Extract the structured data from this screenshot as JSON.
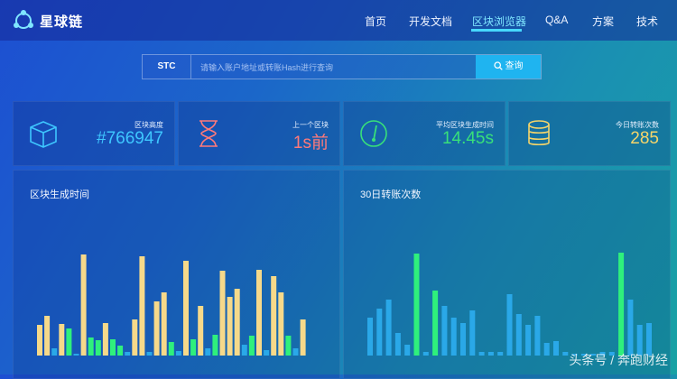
{
  "header": {
    "logo_text": "星球链",
    "nav": [
      {
        "label": "首页"
      },
      {
        "label": "开发文档"
      },
      {
        "label": "区块浏览器",
        "active": true
      },
      {
        "label": "Q&A"
      },
      {
        "label": "方案"
      },
      {
        "label": "技术"
      }
    ]
  },
  "search": {
    "token": "STC",
    "placeholder": "请输入账户地址或转账Hash进行查询",
    "button_label": "查询"
  },
  "stats": [
    {
      "icon": "cube-icon",
      "label": "区块高度",
      "value": "#766947",
      "color": "#3ec7ff"
    },
    {
      "icon": "hourglass-icon",
      "label": "上一个区块",
      "value": "1s前",
      "color": "#ff7a7a"
    },
    {
      "icon": "gauge-icon",
      "label": "平均区块生成时间",
      "value": "14.45s",
      "color": "#38e07a"
    },
    {
      "icon": "database-icon",
      "label": "今日转账次数",
      "value": "285",
      "color": "#f5d56a"
    }
  ],
  "panels": {
    "block_time_title": "区块生成时间",
    "tx_count_title": "30日转账次数"
  },
  "watermark": "头条号 / 奔跑财经",
  "chart_data": [
    {
      "type": "bar",
      "title": "区块生成时间",
      "colors": {
        "yellow": "#f6d98a",
        "green": "#2ff07c",
        "blue": "#2aa8e8"
      },
      "values": [
        {
          "v": 34,
          "c": "yellow"
        },
        {
          "v": 44,
          "c": "yellow"
        },
        {
          "v": 8,
          "c": "blue"
        },
        {
          "v": 35,
          "c": "yellow"
        },
        {
          "v": 30,
          "c": "green"
        },
        {
          "v": 2,
          "c": "blue"
        },
        {
          "v": 112,
          "c": "yellow"
        },
        {
          "v": 20,
          "c": "green"
        },
        {
          "v": 17,
          "c": "green"
        },
        {
          "v": 36,
          "c": "yellow"
        },
        {
          "v": 18,
          "c": "green"
        },
        {
          "v": 11,
          "c": "green"
        },
        {
          "v": 4,
          "c": "blue"
        },
        {
          "v": 40,
          "c": "yellow"
        },
        {
          "v": 110,
          "c": "yellow"
        },
        {
          "v": 4,
          "c": "blue"
        },
        {
          "v": 60,
          "c": "yellow"
        },
        {
          "v": 70,
          "c": "yellow"
        },
        {
          "v": 15,
          "c": "green"
        },
        {
          "v": 5,
          "c": "blue"
        },
        {
          "v": 105,
          "c": "yellow"
        },
        {
          "v": 18,
          "c": "green"
        },
        {
          "v": 55,
          "c": "yellow"
        },
        {
          "v": 8,
          "c": "blue"
        },
        {
          "v": 23,
          "c": "green"
        },
        {
          "v": 94,
          "c": "yellow"
        },
        {
          "v": 65,
          "c": "yellow"
        },
        {
          "v": 74,
          "c": "yellow"
        },
        {
          "v": 12,
          "c": "blue"
        },
        {
          "v": 22,
          "c": "green"
        },
        {
          "v": 95,
          "c": "yellow"
        },
        {
          "v": 6,
          "c": "blue"
        },
        {
          "v": 88,
          "c": "yellow"
        },
        {
          "v": 70,
          "c": "yellow"
        },
        {
          "v": 22,
          "c": "green"
        },
        {
          "v": 8,
          "c": "blue"
        },
        {
          "v": 40,
          "c": "yellow"
        }
      ]
    },
    {
      "type": "bar",
      "title": "30日转账次数",
      "colors": {
        "green": "#2ff07c",
        "blue": "#2aa8e8"
      },
      "values": [
        {
          "v": 42,
          "c": "blue"
        },
        {
          "v": 52,
          "c": "blue"
        },
        {
          "v": 62,
          "c": "blue"
        },
        {
          "v": 25,
          "c": "blue"
        },
        {
          "v": 12,
          "c": "blue"
        },
        {
          "v": 113,
          "c": "green"
        },
        {
          "v": 4,
          "c": "blue"
        },
        {
          "v": 72,
          "c": "green"
        },
        {
          "v": 55,
          "c": "blue"
        },
        {
          "v": 42,
          "c": "blue"
        },
        {
          "v": 36,
          "c": "blue"
        },
        {
          "v": 50,
          "c": "blue"
        },
        {
          "v": 4,
          "c": "blue"
        },
        {
          "v": 4,
          "c": "blue"
        },
        {
          "v": 4,
          "c": "blue"
        },
        {
          "v": 68,
          "c": "blue"
        },
        {
          "v": 46,
          "c": "blue"
        },
        {
          "v": 34,
          "c": "blue"
        },
        {
          "v": 44,
          "c": "blue"
        },
        {
          "v": 14,
          "c": "blue"
        },
        {
          "v": 16,
          "c": "blue"
        },
        {
          "v": 4,
          "c": "blue"
        },
        {
          "v": 2,
          "c": "blue"
        },
        {
          "v": 2,
          "c": "blue"
        },
        {
          "v": 2,
          "c": "blue"
        },
        {
          "v": 4,
          "c": "blue"
        },
        {
          "v": 4,
          "c": "blue"
        },
        {
          "v": 114,
          "c": "green"
        },
        {
          "v": 62,
          "c": "blue"
        },
        {
          "v": 34,
          "c": "blue"
        },
        {
          "v": 36,
          "c": "blue"
        }
      ]
    }
  ]
}
